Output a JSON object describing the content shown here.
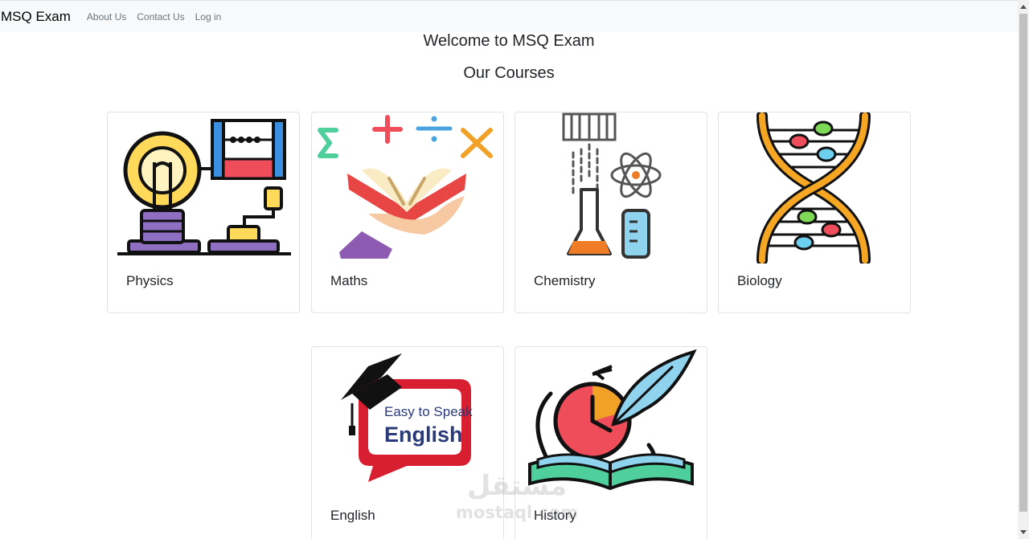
{
  "navbar": {
    "brand": "MSQ Exam",
    "links": [
      "About Us",
      "Contact Us",
      "Log in"
    ]
  },
  "main": {
    "welcome": "Welcome to MSQ Exam",
    "courses_title": "Our Courses",
    "courses": [
      {
        "label": "Physics",
        "icon": "physics-lightbulb-abacus-icon"
      },
      {
        "label": "Maths",
        "icon": "maths-book-symbols-icon"
      },
      {
        "label": "Chemistry",
        "icon": "chemistry-flask-atom-icon"
      },
      {
        "label": "Biology",
        "icon": "biology-dna-icon"
      },
      {
        "label": "English",
        "icon": "english-speech-bubble-icon",
        "image_text": [
          "Easy to Speak",
          "English"
        ]
      },
      {
        "label": "History",
        "icon": "history-clock-book-quill-icon"
      }
    ]
  },
  "watermark": {
    "arabic": "مستقل",
    "latin": "mostaql.com"
  }
}
